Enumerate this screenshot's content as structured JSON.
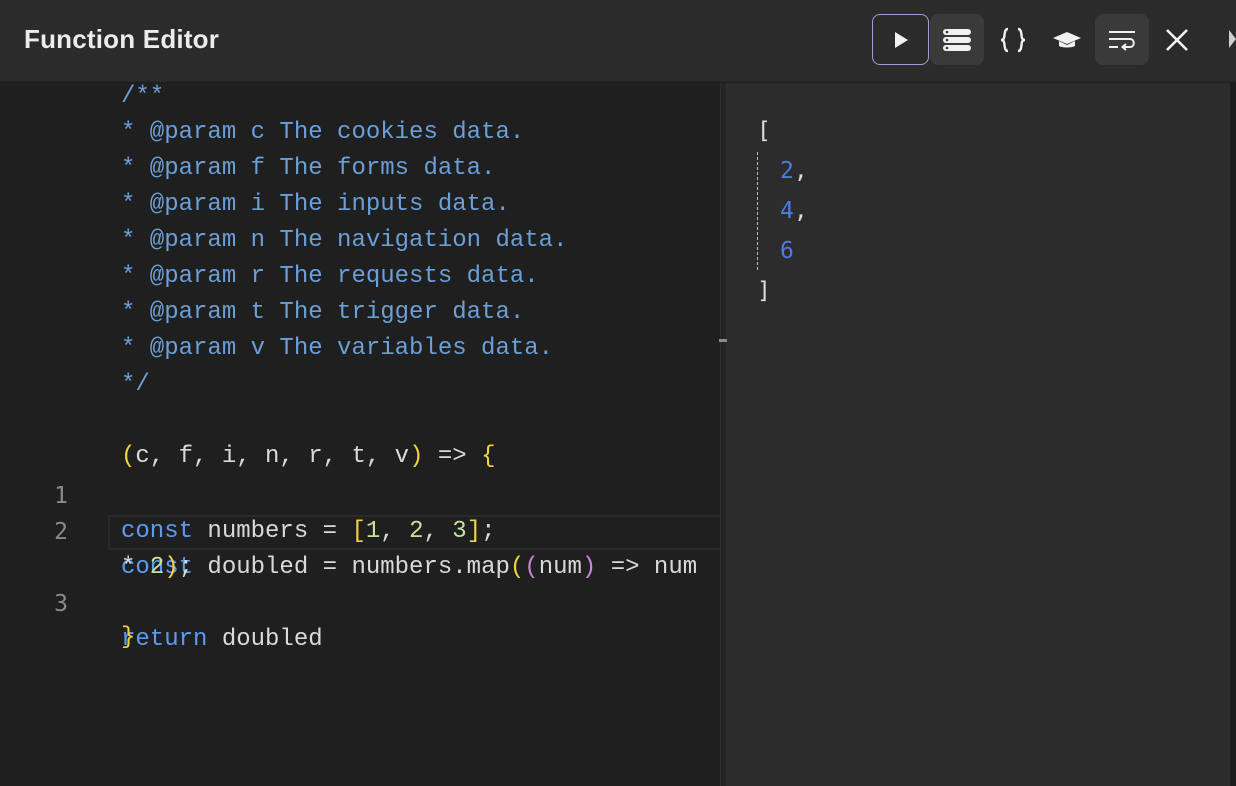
{
  "header": {
    "title": "Function Editor",
    "buttons": {
      "run": "play-icon",
      "results": "stack-icon",
      "format": "braces-icon",
      "learn": "graduation-cap-icon",
      "wrap": "wrap-text-icon",
      "close": "close-icon"
    },
    "accent": "#a79bd9"
  },
  "editor": {
    "doc_comment": [
      "/**",
      "* @param c The cookies data.",
      "* @param f The forms data.",
      "* @param i The inputs data.",
      "* @param n The navigation data.",
      "* @param r The requests data.",
      "* @param t The trigger data.",
      "* @param v The variables data.",
      "*/"
    ],
    "signature": {
      "open_paren": "(",
      "params": "c, f, i, n, r, t, v",
      "close_paren": ")",
      "arrow": " => ",
      "open_brace": "{"
    },
    "lines": [
      {
        "number": "1",
        "kw": "const",
        "name": " numbers = ",
        "lb": "[",
        "n1": "1",
        "c1": ", ",
        "n2": "2",
        "c2": ", ",
        "n3": "3",
        "rb": "]",
        "end": ";"
      },
      {
        "number": "2",
        "kw": "const",
        "name": " doubled = numbers.map",
        "p1": "(",
        "p2": "(",
        "arg": "num",
        "p3": ")",
        "body": " => num",
        "wrap_op": "* ",
        "wrap_num": "2",
        "wrap_close": ")",
        "wrap_end": ";"
      },
      {
        "number": "3",
        "kw": "return",
        "rest": " doubled"
      }
    ],
    "close_brace": "}"
  },
  "result": {
    "open": "[",
    "items": [
      "2",
      "4",
      "6"
    ],
    "comma": ",",
    "close": "]"
  }
}
